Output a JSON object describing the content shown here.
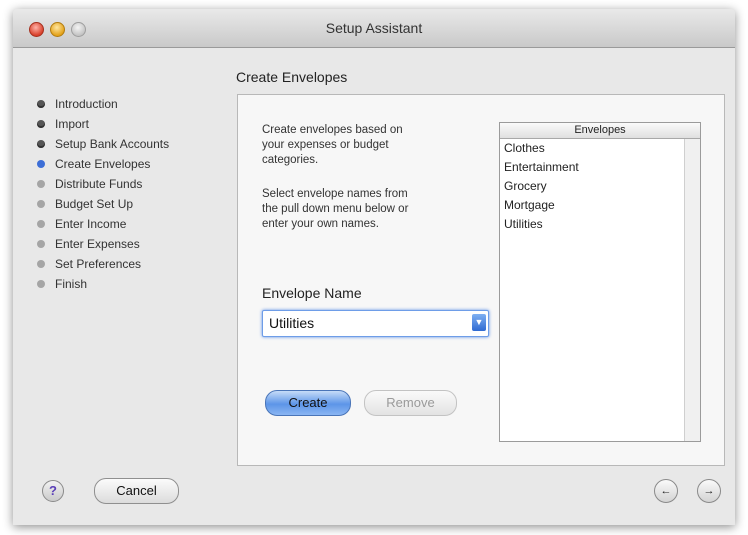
{
  "window": {
    "title": "Setup Assistant"
  },
  "steps": [
    {
      "label": "Introduction",
      "state": "done"
    },
    {
      "label": "Import",
      "state": "done"
    },
    {
      "label": "Setup Bank Accounts",
      "state": "done"
    },
    {
      "label": "Create Envelopes",
      "state": "current"
    },
    {
      "label": "Distribute Funds",
      "state": "pending"
    },
    {
      "label": "Budget Set Up",
      "state": "pending"
    },
    {
      "label": "Enter Income",
      "state": "pending"
    },
    {
      "label": "Enter Expenses",
      "state": "pending"
    },
    {
      "label": "Set Preferences",
      "state": "pending"
    },
    {
      "label": "Finish",
      "state": "pending"
    }
  ],
  "main": {
    "section_title": "Create Envelopes",
    "instructions_1": "Create envelopes based on\nyour expenses or budget\ncategories.",
    "instructions_2": "Select envelope names from\nthe pull down menu below or\nenter your own names.",
    "envelope_name_label": "Envelope Name",
    "envelope_name_value": "Utilities",
    "create_label": "Create",
    "remove_label": "Remove",
    "envelopes_header": "Envelopes",
    "envelopes": [
      "Clothes",
      "Entertainment",
      "Grocery",
      "Mortgage",
      "Utilities"
    ]
  },
  "footer": {
    "help_label": "?",
    "cancel_label": "Cancel",
    "back_icon": "arrow-back-icon",
    "forward_icon": "arrow-forward-icon"
  },
  "colors": {
    "accent": "#3d6ed6",
    "focus": "#6e9de8"
  }
}
